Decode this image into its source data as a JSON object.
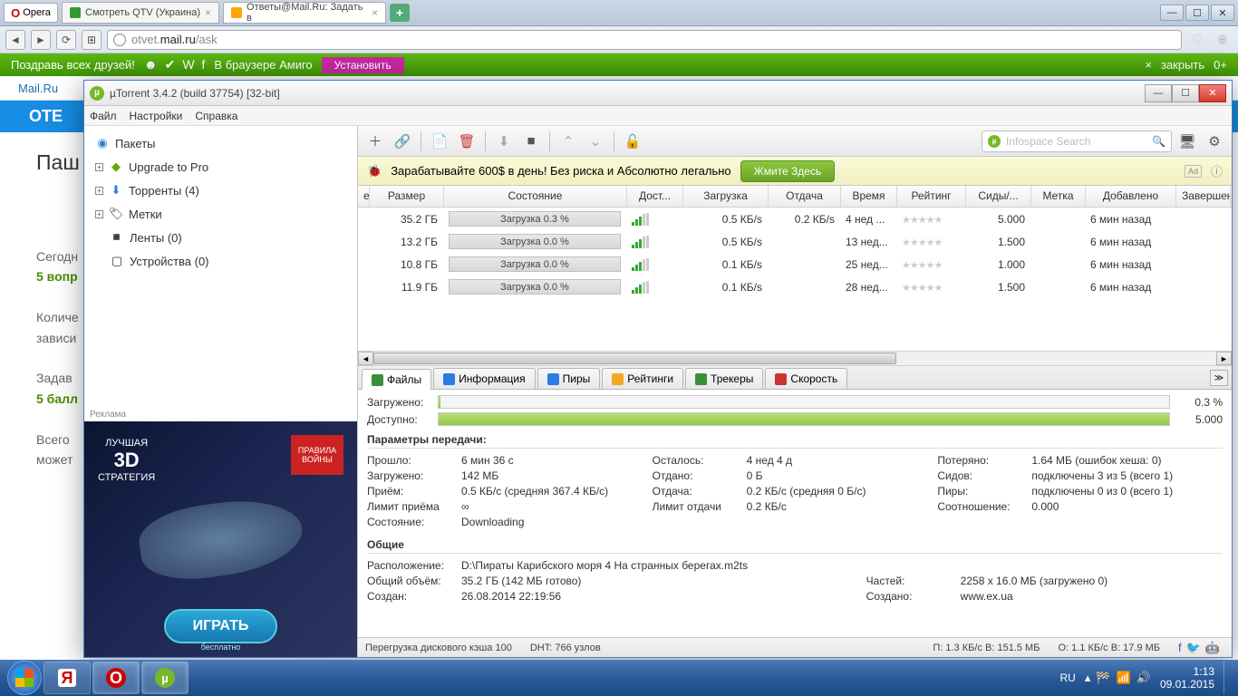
{
  "browser": {
    "app": "Opera",
    "tabs": [
      {
        "title": "Смотреть QTV (Украина)",
        "active": false
      },
      {
        "title": "Ответы@Mail.Ru: Задать в",
        "active": true
      }
    ],
    "url_prefix": "otvet.",
    "url_domain": "mail.ru",
    "url_path": "/ask"
  },
  "greenbar": {
    "text1": "Поздравь всех друзей!",
    "text2": "В браузере Амиго",
    "install": "Установить",
    "close": "закрыть",
    "zero": "0+"
  },
  "mailru": {
    "link": "Mail.Ru"
  },
  "bluehead": "ОТЕ",
  "page": {
    "heading_partial": "Паш",
    "t1a": "Сегодн",
    "t1b": "5 вопр",
    "t2a": "Количе",
    "t2b": "зависи",
    "t3a": "Задав",
    "t3b": "5 балл",
    "t4a": "Всего",
    "t4b": "может"
  },
  "utorrent": {
    "title": "µTorrent 3.4.2  (build 37754) [32-bit]",
    "menu": [
      "Файл",
      "Настройки",
      "Справка"
    ],
    "tree": {
      "packages": "Пакеты",
      "upgrade": "Upgrade to Pro",
      "torrents": "Торренты (4)",
      "labels": "Метки",
      "feeds": "Ленты (0)",
      "devices": "Устройства (0)"
    },
    "ad_label": "Реклама",
    "side_ad": {
      "tag1": "ЛУЧШАЯ",
      "tag2": "3D",
      "tag3": "СТРАТЕГИЯ",
      "badge": "ПРАВИЛА ВОЙНЫ",
      "play": "ИГРАТЬ",
      "free": "бесплатно"
    },
    "search_placeholder": "Infospace Search",
    "banner": {
      "text": "Зарабатывайте 600$ в день! Без риска и Абсолютно легально",
      "btn": "Жмите Здесь",
      "tag": "Ad"
    },
    "cols": {
      "e": "е",
      "size": "Размер",
      "state": "Состояние",
      "avail": "Дост...",
      "dl": "Загрузка",
      "ul": "Отдача",
      "time": "Время",
      "rate": "Рейтинг",
      "seeds": "Сиды/...",
      "label": "Метка",
      "added": "Добавлено",
      "done": "Завершено"
    },
    "rows": [
      {
        "size": "35.2 ГБ",
        "state": "Загрузка 0.3 %",
        "dl": "0.5 КБ/s",
        "ul": "0.2 КБ/s",
        "time": "4 нед ...",
        "seeds": "5.000",
        "added": "6 мин назад"
      },
      {
        "size": "13.2 ГБ",
        "state": "Загрузка 0.0 %",
        "dl": "0.5 КБ/s",
        "ul": "",
        "time": "13 нед...",
        "seeds": "1.500",
        "added": "6 мин назад"
      },
      {
        "size": "10.8 ГБ",
        "state": "Загрузка 0.0 %",
        "dl": "0.1 КБ/s",
        "ul": "",
        "time": "25 нед...",
        "seeds": "1.000",
        "added": "6 мин назад"
      },
      {
        "size": "11.9 ГБ",
        "state": "Загрузка 0.0 %",
        "dl": "0.1 КБ/s",
        "ul": "",
        "time": "28 нед...",
        "seeds": "1.500",
        "added": "6 мин назад"
      }
    ],
    "tabs": [
      "Файлы",
      "Информация",
      "Пиры",
      "Рейтинги",
      "Трекеры",
      "Скорость"
    ],
    "info": {
      "loaded_l": "Загружено:",
      "loaded_v": "0.3 %",
      "avail_l": "Доступно:",
      "avail_v": "5.000",
      "sect_transfer": "Параметры передачи:",
      "elapsed_k": "Прошло:",
      "elapsed_v": "6 мин 36 с",
      "remaining_k": "Осталось:",
      "remaining_v": "4 нед 4 д",
      "wasted_k": "Потеряно:",
      "wasted_v": "1.64 МБ (ошибок хеша: 0)",
      "downloaded_k": "Загружено:",
      "downloaded_v": "142 МБ",
      "uploaded_k": "Отдано:",
      "uploaded_v": "0 Б",
      "seeds_k": "Сидов:",
      "seeds_v": "подключены 3 из 5 (всего 1)",
      "dlspeed_k": "Приём:",
      "dlspeed_v": "0.5 КБ/с (средняя 367.4 КБ/с)",
      "ulspeed_k": "Отдача:",
      "ulspeed_v": "0.2 КБ/с (средняя 0 Б/с)",
      "peers_k": "Пиры:",
      "peers_v": "подключены 0 из 0 (всего 1)",
      "dllimit_k": "Лимит приёма",
      "dllimit_v": "∞",
      "ullimit_k": "Лимит отдачи",
      "ullimit_v": "0.2 КБ/с",
      "ratio_k": "Соотношение:",
      "ratio_v": "0.000",
      "status_k": "Состояние:",
      "status_v": "Downloading",
      "sect_general": "Общие",
      "path_k": "Расположение:",
      "path_v": "D:\\Пираты Карибского моря 4 На странных берегах.m2ts",
      "total_k": "Общий объём:",
      "total_v": "35.2 ГБ (142 МБ готово)",
      "pieces_k": "Частей:",
      "pieces_v": "2258 x 16.0 МБ (загружено 0)",
      "created_k": "Создан:",
      "created_v": "26.08.2014 22:19:56",
      "createdby_k": "Создано:",
      "createdby_v": "www.ex.ua"
    },
    "status": {
      "s1": "Перегрузка дискового кэша 100",
      "s2": "DHT: 766 узлов",
      "s3": "П: 1.3 КБ/с В: 151.5 МБ",
      "s4": "О: 1.1 КБ/с В: 17.9 МБ"
    }
  },
  "taskbar": {
    "lang": "RU",
    "time": "1:13",
    "date": "09.01.2015"
  }
}
